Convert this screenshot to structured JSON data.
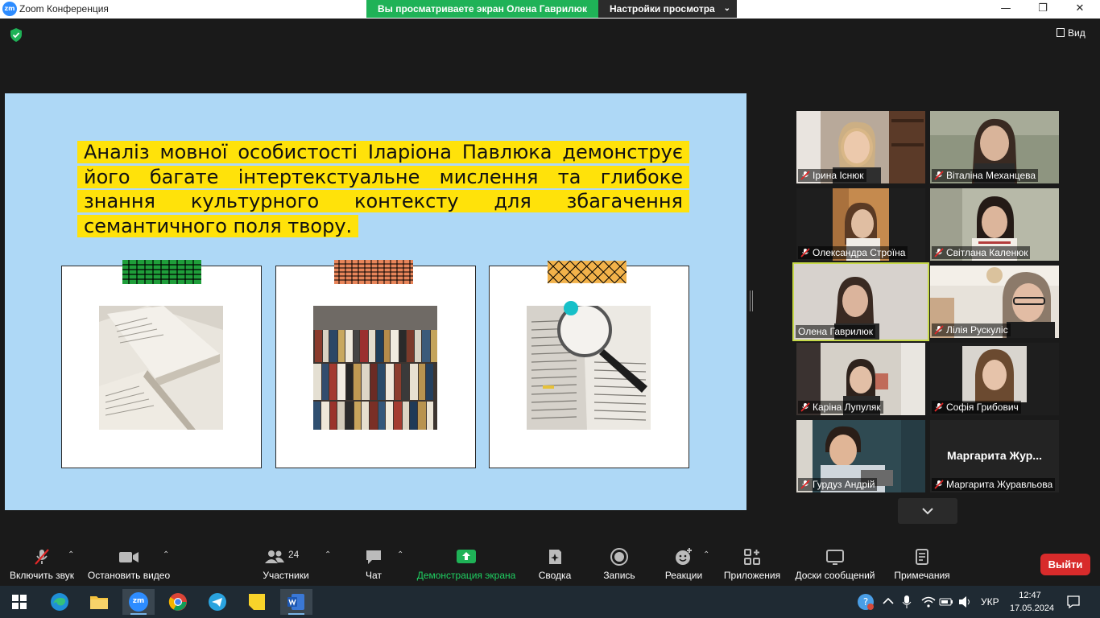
{
  "window": {
    "title": "Zoom Конференция",
    "logo_text": "zm",
    "controls": {
      "minimize": "—",
      "maximize": "❐",
      "close": "✕"
    }
  },
  "share": {
    "banner": "Вы просматриваете экран Олена Гаврилюк",
    "view_settings": "Настройки просмотра"
  },
  "view_button": "Вид",
  "slide": {
    "quote": "Аналіз мовної особистості Іларіона Павлюка демонструє його багате інтертекстуальне мислення та глибоке знання культурного контексту для збагачення семантичного поля твору."
  },
  "participants": [
    {
      "name": "Ірина Існюк",
      "muted": true
    },
    {
      "name": "Віталіна Механцева",
      "muted": true
    },
    {
      "name": "Олександра Строїна",
      "muted": true
    },
    {
      "name": "Світлана Каленюк",
      "muted": true
    },
    {
      "name": "Олена Гаврилюк",
      "muted": false,
      "active": true
    },
    {
      "name": "Лілія Рускуліс",
      "muted": true
    },
    {
      "name": "Каріна Лупуляк",
      "muted": true
    },
    {
      "name": "Софія Грибович",
      "muted": true
    },
    {
      "name": "Гурдуз Андрій",
      "muted": true
    },
    {
      "name": "Маргарита Журавльова",
      "muted": true,
      "display_label": "Маргарита Жур..."
    }
  ],
  "toolbar": {
    "mute": "Включить звук",
    "video": "Остановить видео",
    "participants": "Участники",
    "participants_count": "24",
    "chat": "Чат",
    "share": "Демонстрация экрана",
    "summary": "Сводка",
    "record": "Запись",
    "reactions": "Реакции",
    "apps": "Приложения",
    "whiteboards": "Доски сообщений",
    "notes": "Примечания",
    "leave": "Выйти"
  },
  "taskbar": {
    "language": "УКР",
    "time": "12:47",
    "date": "17.05.2024",
    "zoom_label": "zm"
  },
  "colors": {
    "share_green": "#1fb257",
    "slide_bg": "#aed8f6",
    "highlight": "#ffe20a",
    "leave_red": "#d82b2b",
    "active_speaker": "#c7d94a"
  }
}
